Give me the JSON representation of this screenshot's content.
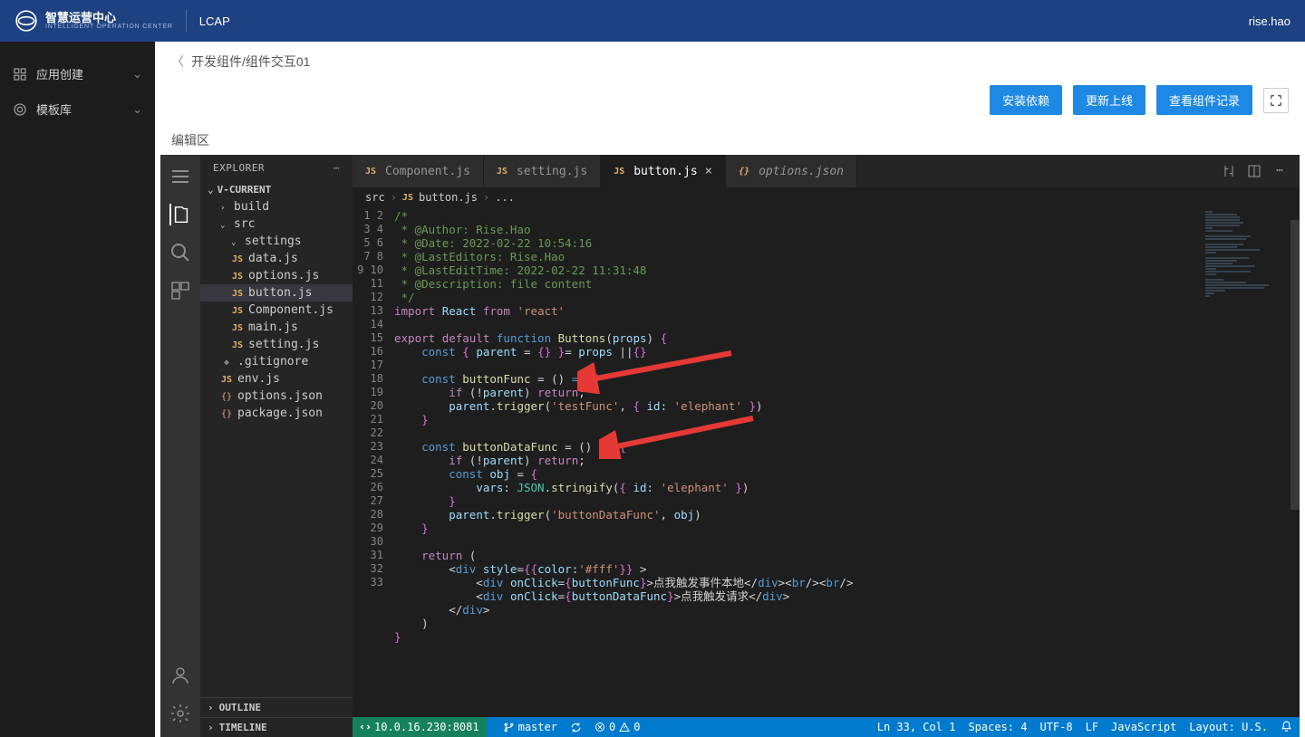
{
  "header": {
    "brand_cn": "智慧运营中心",
    "brand_en": "INTELLIGENT OPERATION CENTER",
    "product": "LCAP",
    "user": "rise.hao"
  },
  "leftnav": {
    "items": [
      {
        "label": "应用创建"
      },
      {
        "label": "模板库"
      }
    ]
  },
  "content_header": {
    "breadcrumb": "开发组件/组件交互01"
  },
  "actions": {
    "install": "安装依赖",
    "deploy": "更新上线",
    "logs": "查看组件记录"
  },
  "editor_label": "编辑区",
  "explorer": {
    "title": "EXPLORER",
    "root": "V-CURRENT",
    "outline": "OUTLINE",
    "timeline": "TIMELINE",
    "tree": [
      {
        "label": "build",
        "depth": 1,
        "type": "folder",
        "expanded": false
      },
      {
        "label": "src",
        "depth": 1,
        "type": "folder",
        "expanded": true
      },
      {
        "label": "settings",
        "depth": 2,
        "type": "folder",
        "expanded": true
      },
      {
        "label": "data.js",
        "depth": 2,
        "type": "js"
      },
      {
        "label": "options.js",
        "depth": 2,
        "type": "js"
      },
      {
        "label": "button.js",
        "depth": 2,
        "type": "js",
        "selected": true
      },
      {
        "label": "Component.js",
        "depth": 2,
        "type": "js"
      },
      {
        "label": "main.js",
        "depth": 2,
        "type": "js"
      },
      {
        "label": "setting.js",
        "depth": 2,
        "type": "js"
      },
      {
        "label": ".gitignore",
        "depth": 1,
        "type": "git"
      },
      {
        "label": "env.js",
        "depth": 1,
        "type": "js"
      },
      {
        "label": "options.json",
        "depth": 1,
        "type": "json"
      },
      {
        "label": "package.json",
        "depth": 1,
        "type": "json"
      }
    ]
  },
  "tabs": [
    {
      "label": "Component.js",
      "icon": "JS"
    },
    {
      "label": "setting.js",
      "icon": "JS"
    },
    {
      "label": "button.js",
      "icon": "JS",
      "active": true,
      "close": true
    },
    {
      "label": "options.json",
      "icon": "{}",
      "italic": true
    }
  ],
  "breadcrumb": {
    "parts": [
      "src",
      "button.js",
      "..."
    ],
    "icon": "JS"
  },
  "code": {
    "lang": "JavaScript"
  },
  "statusbar": {
    "remote": "10.0.16.230:8081",
    "branch": "master",
    "errors": "0",
    "warnings": "0",
    "position": "Ln 33, Col 1",
    "spaces": "Spaces: 4",
    "encoding": "UTF-8",
    "eol": "LF",
    "lang": "JavaScript",
    "layout": "Layout: U.S."
  }
}
